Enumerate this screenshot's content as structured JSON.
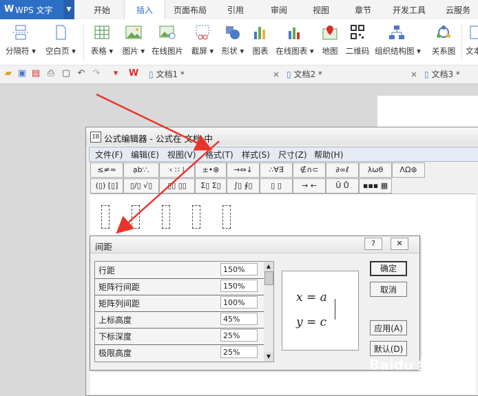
{
  "app": {
    "logo": "W",
    "name": "WPS 文字"
  },
  "tabs": [
    "开始",
    "插入",
    "页面布局",
    "引用",
    "审阅",
    "视图",
    "章节",
    "开发工具",
    "云服务"
  ],
  "active_tab": "插入",
  "ribbon": [
    "分隔符 ▾",
    "空白页 ▾",
    "表格 ▾",
    "图片 ▾",
    "在线图片",
    "截屏 ▾",
    "形状 ▾",
    "图表",
    "在线图表 ▾",
    "地图",
    "二维码",
    "组织结构图 ▾",
    "关系图",
    "文本"
  ],
  "documents": [
    {
      "name": "文档1 *",
      "close": "×"
    },
    {
      "name": "文档2 *",
      "close": "×"
    },
    {
      "name": "文档3 *",
      "close": "×"
    }
  ],
  "equation_editor": {
    "icon": "ΣB",
    "title": "公式编辑器 - 公式在 文档 中",
    "menu": [
      "文件(F)",
      "编辑(E)",
      "视图(V)",
      "格式(T)",
      "样式(S)",
      "尺寸(Z)",
      "帮助(H)"
    ],
    "palette_row1": [
      "≤≠≈",
      "ạb∵.",
      "‹ ∷ ⁞",
      "±•⊗",
      "→⇔↓",
      "∴∀∃",
      "∉∩⊂",
      "∂∞ℓ",
      "λωθ",
      "ΛΩ⊛"
    ],
    "palette_row2": [
      "(▯) [▯]",
      "▯/▯ √▯",
      "▯▯ ▯▯",
      "Σ▯ Σ▯",
      "∫▯ ∮▯",
      "▯ ▯",
      "→ ←",
      "Ū Ů",
      "▪▪▪ ▦"
    ]
  },
  "spacing_dialog": {
    "title": "间距",
    "help_button": "?",
    "close_button": "✕",
    "rows": [
      {
        "name": "行距",
        "value": "150%"
      },
      {
        "name": "矩阵行间距",
        "value": "150%"
      },
      {
        "name": "矩阵列间距",
        "value": "100%"
      },
      {
        "name": "上标高度",
        "value": "45%"
      },
      {
        "name": "下标深度",
        "value": "25%"
      },
      {
        "name": "极限高度",
        "value": "25%"
      }
    ],
    "preview": {
      "line1": "x = a",
      "line2": "y = c"
    },
    "buttons": {
      "ok": "确定",
      "cancel": "取消",
      "apply": "应用(A)",
      "default": "默认(D)"
    }
  },
  "watermark": {
    "text": "Baidu 经验",
    "url": "jingyan.baidu.com"
  },
  "colors": {
    "accent": "#2e6fc6",
    "arrow": "#e8352b",
    "wps_red": "#d9322a"
  }
}
